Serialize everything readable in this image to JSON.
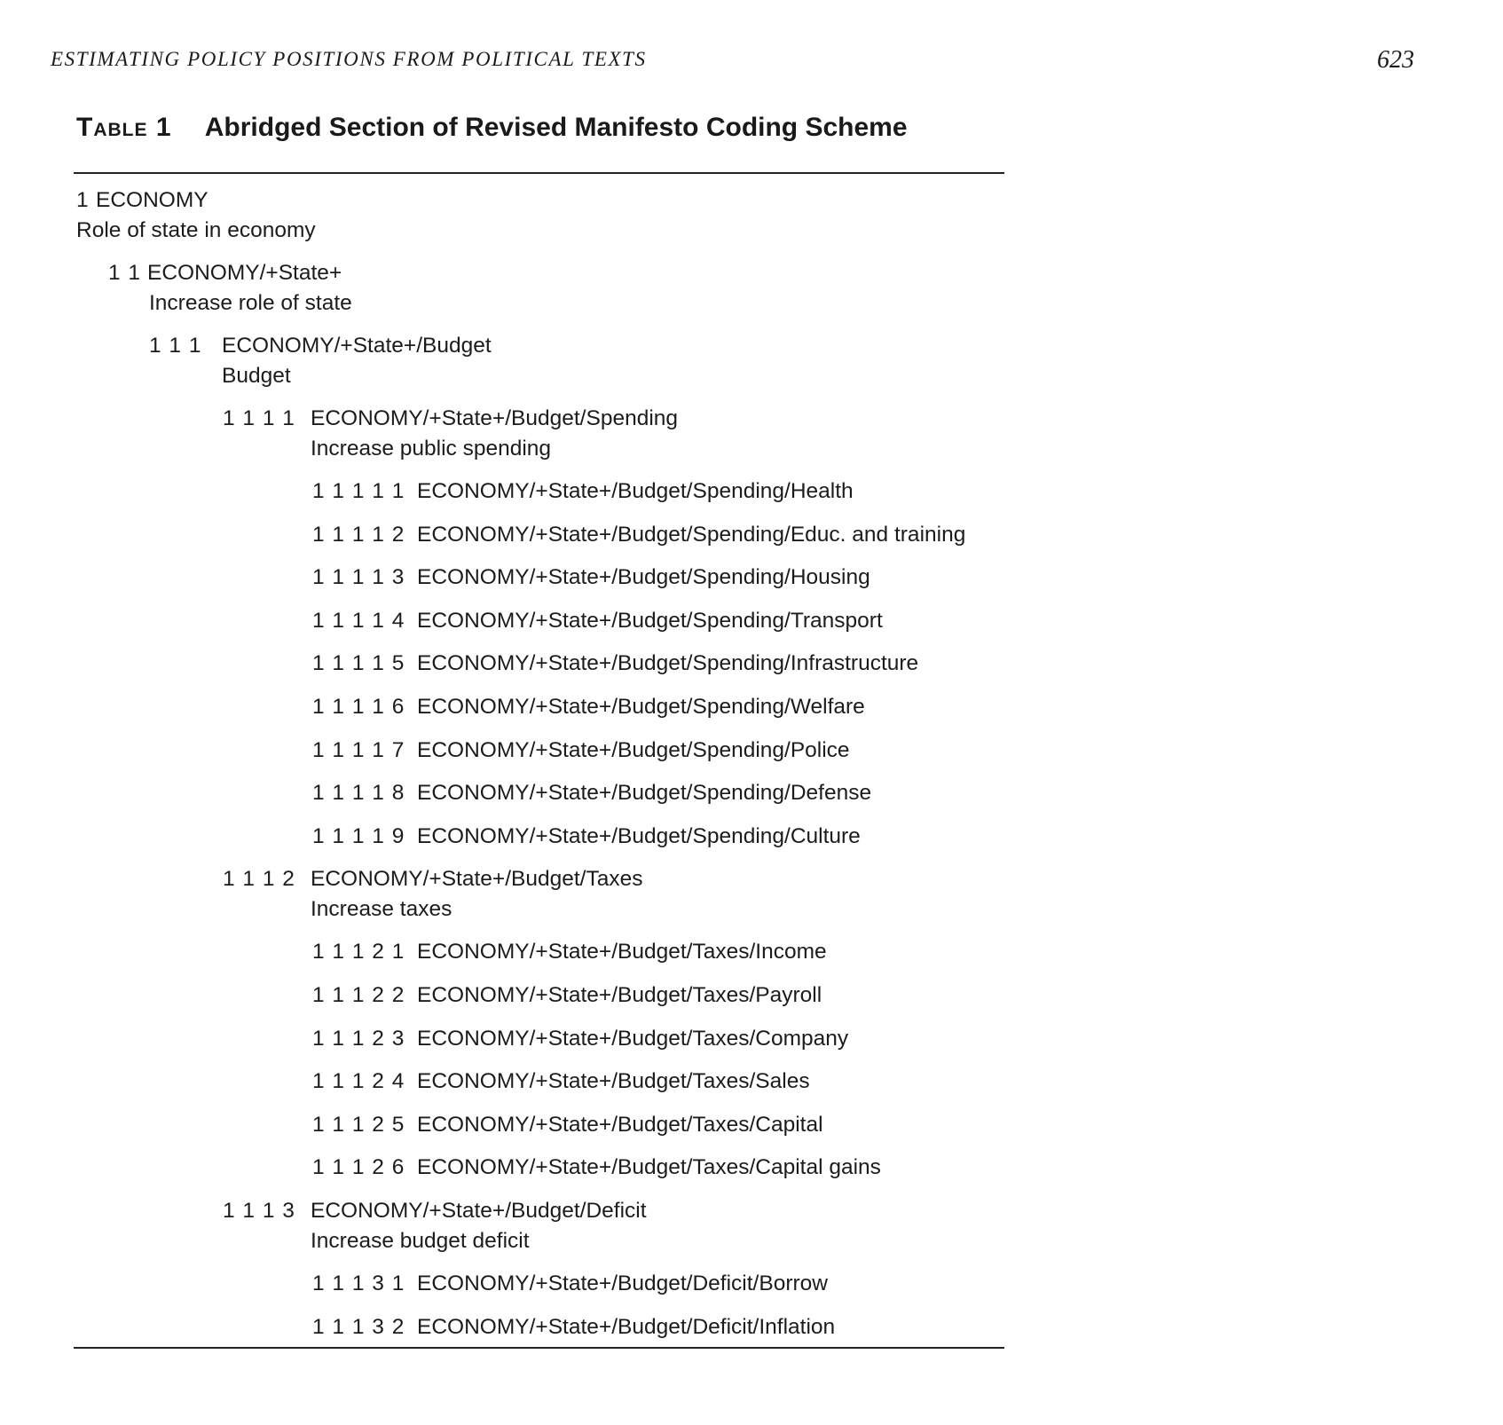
{
  "header": {
    "running_title": "ESTIMATING POLICY POSITIONS FROM POLITICAL TEXTS",
    "page_number": "623"
  },
  "table": {
    "label": "Table 1",
    "title": "Abridged Section of Revised Manifesto Coding Scheme",
    "entries": [
      {
        "code": "1",
        "path": "ECONOMY",
        "description": "Role of state in economy"
      },
      {
        "code": "1 1",
        "path": "ECONOMY/+State+",
        "description": "Increase role of state"
      },
      {
        "code": "1 1 1",
        "path": "ECONOMY/+State+/Budget",
        "description": "Budget"
      },
      {
        "code": "1 1 1 1",
        "path": "ECONOMY/+State+/Budget/Spending",
        "description": "Increase public spending"
      },
      {
        "code": "1 1 1 1 1",
        "path": "ECONOMY/+State+/Budget/Spending/Health"
      },
      {
        "code": "1 1 1 1 2",
        "path": "ECONOMY/+State+/Budget/Spending/Educ. and training"
      },
      {
        "code": "1 1 1 1 3",
        "path": "ECONOMY/+State+/Budget/Spending/Housing"
      },
      {
        "code": "1 1 1 1 4",
        "path": "ECONOMY/+State+/Budget/Spending/Transport"
      },
      {
        "code": "1 1 1 1 5",
        "path": "ECONOMY/+State+/Budget/Spending/Infrastructure"
      },
      {
        "code": "1 1 1 1 6",
        "path": "ECONOMY/+State+/Budget/Spending/Welfare"
      },
      {
        "code": "1 1 1 1 7",
        "path": "ECONOMY/+State+/Budget/Spending/Police"
      },
      {
        "code": "1 1 1 1 8",
        "path": "ECONOMY/+State+/Budget/Spending/Defense"
      },
      {
        "code": "1 1 1 1 9",
        "path": "ECONOMY/+State+/Budget/Spending/Culture"
      },
      {
        "code": "1 1 1 2",
        "path": "ECONOMY/+State+/Budget/Taxes",
        "description": "Increase taxes"
      },
      {
        "code": "1 1 1 2 1",
        "path": "ECONOMY/+State+/Budget/Taxes/Income"
      },
      {
        "code": "1 1 1 2 2",
        "path": "ECONOMY/+State+/Budget/Taxes/Payroll"
      },
      {
        "code": "1 1 1 2 3",
        "path": "ECONOMY/+State+/Budget/Taxes/Company"
      },
      {
        "code": "1 1 1 2 4",
        "path": "ECONOMY/+State+/Budget/Taxes/Sales"
      },
      {
        "code": "1 1 1 2 5",
        "path": "ECONOMY/+State+/Budget/Taxes/Capital"
      },
      {
        "code": "1 1 1 2 6",
        "path": "ECONOMY/+State+/Budget/Taxes/Capital gains"
      },
      {
        "code": "1 1 1 3",
        "path": "ECONOMY/+State+/Budget/Deficit",
        "description": "Increase budget deficit"
      },
      {
        "code": "1 1 1 3 1",
        "path": "ECONOMY/+State+/Budget/Deficit/Borrow"
      },
      {
        "code": "1 1 1 3 2",
        "path": "ECONOMY/+State+/Budget/Deficit/Inflation"
      }
    ]
  }
}
